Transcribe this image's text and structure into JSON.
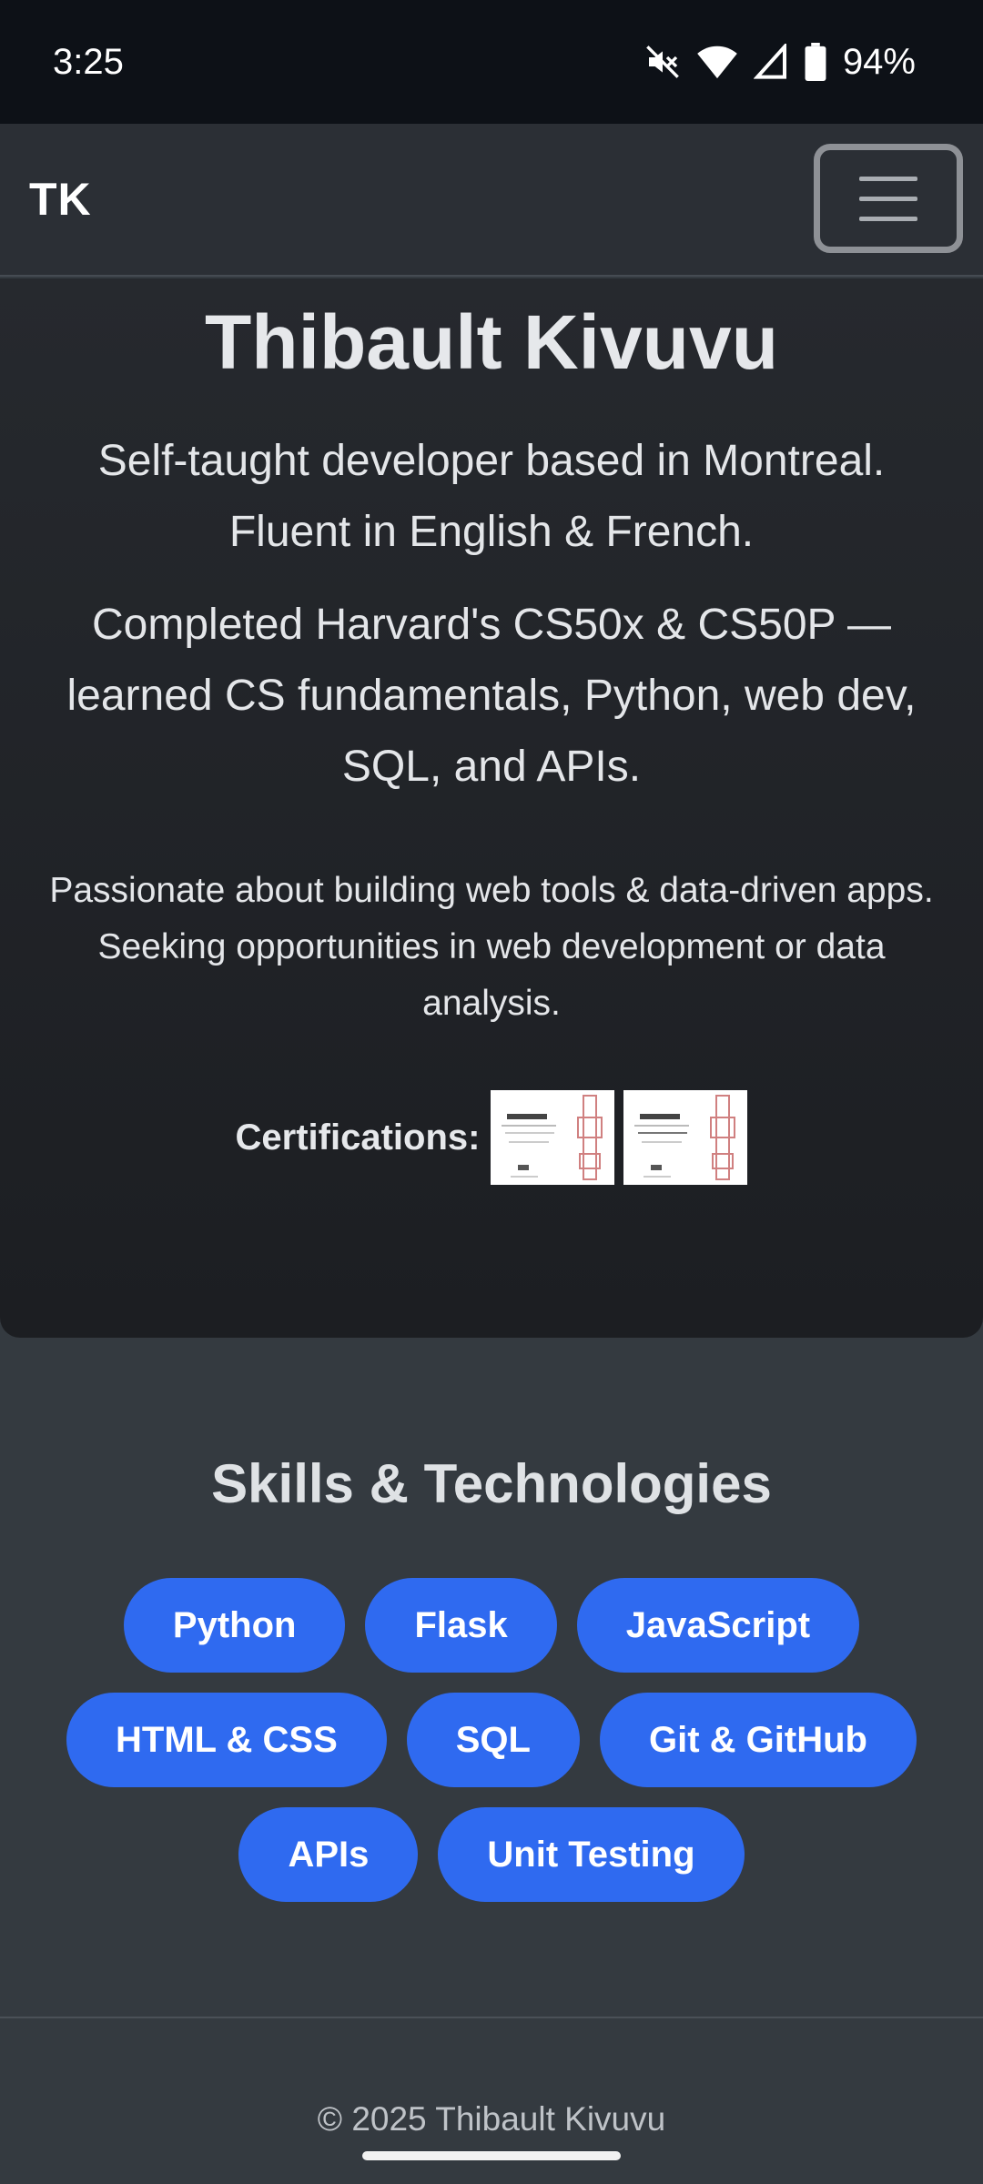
{
  "status_bar": {
    "time": "3:25",
    "battery": "94%",
    "icons": [
      "mute-icon",
      "wifi-icon",
      "signal-icon",
      "battery-icon"
    ]
  },
  "navbar": {
    "brand": "TK",
    "menu_icon": "hamburger-icon"
  },
  "hero": {
    "title": "Thibault Kivuvu",
    "lead_1": "Self-taught developer based in Montreal. Fluent in English & French.",
    "lead_2": "Completed Harvard's CS50x & CS50P — learned CS fundamentals, Python, web dev, SQL, and APIs.",
    "paragraph": "Passionate about building web tools & data-driven apps. Seeking opportunities in web development or data analysis.",
    "certifications_label": "Certifications:"
  },
  "skills": {
    "title": "Skills & Technologies",
    "items": [
      "Python",
      "Flask",
      "JavaScript",
      "HTML & CSS",
      "SQL",
      "Git & GitHub",
      "APIs",
      "Unit Testing"
    ]
  },
  "footer": {
    "text": "© 2025 Thibault Kivuvu"
  },
  "colors": {
    "accent": "#2f6af0",
    "background": "#343a40",
    "hero_background": "#1f2226",
    "status_bar": "#0d1117"
  }
}
